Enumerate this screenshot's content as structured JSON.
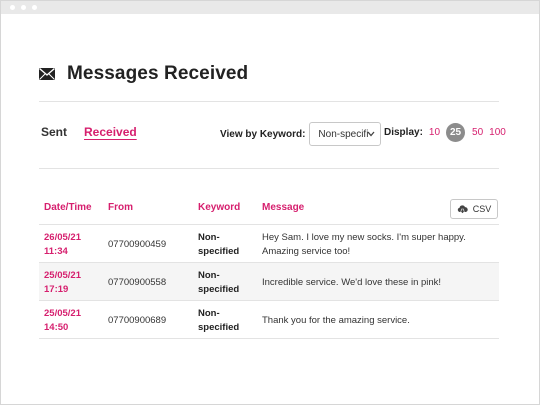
{
  "page": {
    "title": "Messages Received",
    "icon": "envelope-icon"
  },
  "tabs": [
    {
      "label": "Sent",
      "active": false
    },
    {
      "label": "Received",
      "active": true
    }
  ],
  "filter": {
    "label": "View by Keyword:",
    "selected": "Non-specified"
  },
  "display": {
    "label": "Display:",
    "options": [
      "10",
      "25",
      "50",
      "100"
    ],
    "selected": "25"
  },
  "export": {
    "label": "CSV",
    "icon": "cloud-download-icon"
  },
  "table": {
    "columns": [
      "Date/Time",
      "From",
      "Keyword",
      "Message"
    ],
    "rows": [
      {
        "date": "26/05/21",
        "time": "11:34",
        "from": "07700900459",
        "keyword_line1": "Non-",
        "keyword_line2": "specified",
        "message": "Hey Sam. I love my new socks. I'm super happy. Amazing service too!"
      },
      {
        "date": "25/05/21",
        "time": "17:19",
        "from": "07700900558",
        "keyword_line1": "Non-",
        "keyword_line2": "specified",
        "message": "Incredible service. We'd love these in pink!"
      },
      {
        "date": "25/05/21",
        "time": "14:50",
        "from": "07700900689",
        "keyword_line1": "Non-",
        "keyword_line2": "specified",
        "message": "Thank you for the amazing service."
      }
    ]
  },
  "colors": {
    "accent": "#d61f6e",
    "active_page_bg": "#8c8c8c",
    "row_alt_bg": "#f5f5f5"
  }
}
